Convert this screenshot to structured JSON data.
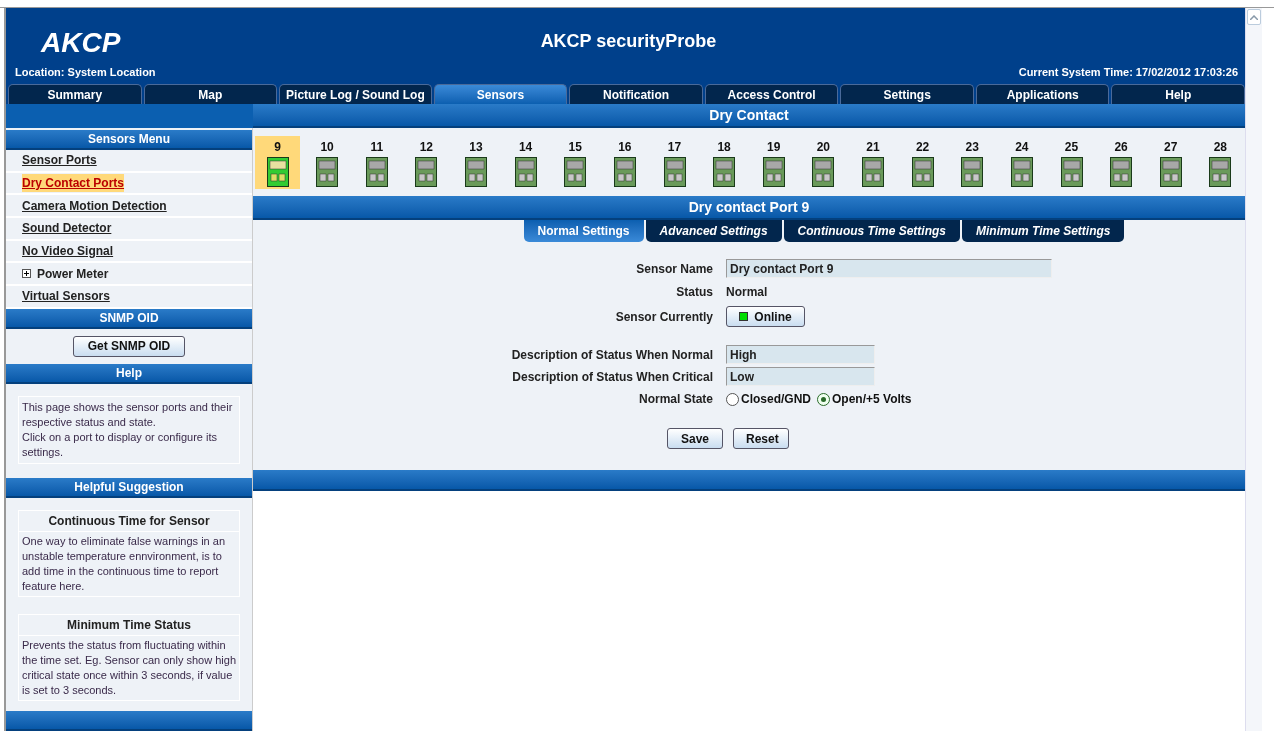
{
  "header": {
    "logo": "AKCP",
    "title": "AKCP securityProbe",
    "location": "Location: System Location",
    "time": "Current System Time: 17/02/2012 17:03:26"
  },
  "tabs": [
    {
      "label": "Summary",
      "selected": false
    },
    {
      "label": "Map",
      "selected": false
    },
    {
      "label": "Picture Log / Sound Log",
      "selected": false
    },
    {
      "label": "Sensors",
      "selected": true
    },
    {
      "label": "Notification",
      "selected": false
    },
    {
      "label": "Access Control",
      "selected": false
    },
    {
      "label": "Settings",
      "selected": false
    },
    {
      "label": "Applications",
      "selected": false
    },
    {
      "label": "Help",
      "selected": false
    }
  ],
  "section_title": "Dry Contact",
  "sidebar": {
    "sensors_menu": {
      "title": "Sensors Menu",
      "items": [
        {
          "label": "Sensor Ports",
          "selected": false,
          "kind": "link"
        },
        {
          "label": "Dry Contact Ports",
          "selected": true,
          "kind": "link"
        },
        {
          "label": "Camera Motion Detection",
          "selected": false,
          "kind": "link"
        },
        {
          "label": "Sound Detector",
          "selected": false,
          "kind": "link"
        },
        {
          "label": "No Video Signal",
          "selected": false,
          "kind": "link"
        },
        {
          "label": "Power Meter",
          "selected": false,
          "kind": "expandable",
          "expanded": false
        },
        {
          "label": "Virtual Sensors",
          "selected": false,
          "kind": "link"
        }
      ]
    },
    "snmp": {
      "title": "SNMP OID",
      "button": "Get SNMP OID"
    },
    "help": {
      "title": "Help",
      "paragraphs": [
        "This page shows the sensor ports and their respective status and state.",
        "Click on a port to display or configure its settings."
      ]
    },
    "suggestion": {
      "title": "Helpful Suggestion",
      "tips": [
        {
          "title": "Continuous Time for Sensor",
          "text": "One way to eliminate false warnings in an unstable temperature ennvironment, is to add time in the continuous time to report feature here."
        },
        {
          "title": "Minimum Time Status",
          "text": "Prevents the status from fluctuating within the time set. Eg. Sensor can only show high critical state once within 3 seconds, if value is set to 3 seconds."
        }
      ]
    }
  },
  "ports": [
    {
      "label": "9",
      "selected": true
    },
    {
      "label": "10",
      "selected": false
    },
    {
      "label": "11",
      "selected": false
    },
    {
      "label": "12",
      "selected": false
    },
    {
      "label": "13",
      "selected": false
    },
    {
      "label": "14",
      "selected": false
    },
    {
      "label": "15",
      "selected": false
    },
    {
      "label": "16",
      "selected": false
    },
    {
      "label": "17",
      "selected": false
    },
    {
      "label": "18",
      "selected": false
    },
    {
      "label": "19",
      "selected": false
    },
    {
      "label": "20",
      "selected": false
    },
    {
      "label": "21",
      "selected": false
    },
    {
      "label": "22",
      "selected": false
    },
    {
      "label": "23",
      "selected": false
    },
    {
      "label": "24",
      "selected": false
    },
    {
      "label": "25",
      "selected": false
    },
    {
      "label": "26",
      "selected": false
    },
    {
      "label": "27",
      "selected": false
    },
    {
      "label": "28",
      "selected": false
    }
  ],
  "port_panel": {
    "title": "Dry contact Port 9",
    "tabs": [
      {
        "label": "Normal Settings",
        "selected": true
      },
      {
        "label": "Advanced Settings",
        "selected": false
      },
      {
        "label": "Continuous Time Settings",
        "selected": false
      },
      {
        "label": "Minimum Time Settings",
        "selected": false
      }
    ],
    "sensor_name": {
      "label": "Sensor Name",
      "value": "Dry contact Port 9"
    },
    "status": {
      "label": "Status",
      "value": "Normal"
    },
    "sensor_currently": {
      "label": "Sensor Currently",
      "value": "Online",
      "color": "#00dd00"
    },
    "desc_normal": {
      "label": "Description of Status When Normal",
      "value": "High"
    },
    "desc_critical": {
      "label": "Description of Status When Critical",
      "value": "Low"
    },
    "normal_state": {
      "label": "Normal State",
      "options": [
        {
          "label": "Closed/GND",
          "selected": false
        },
        {
          "label": "Open/+5 Volts",
          "selected": true
        }
      ]
    },
    "buttons": [
      "Save",
      "Reset"
    ]
  }
}
